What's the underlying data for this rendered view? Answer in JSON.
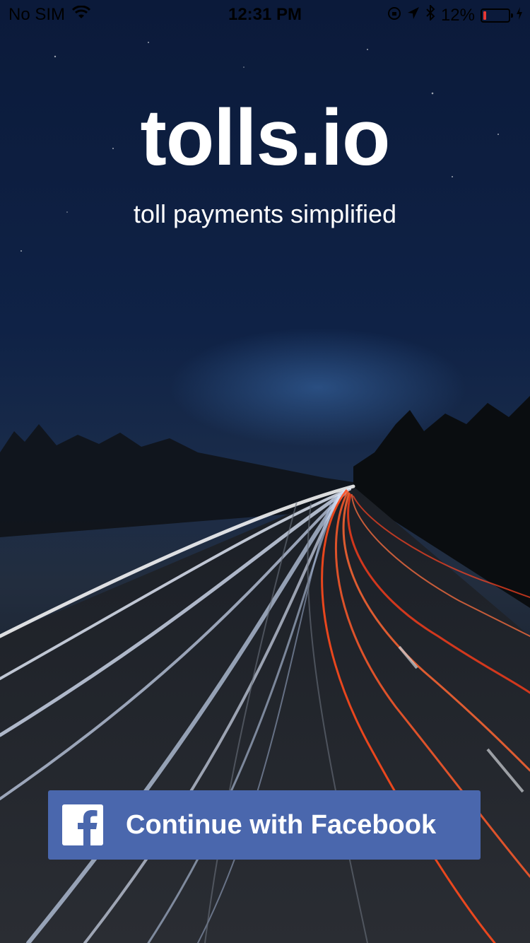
{
  "status_bar": {
    "carrier": "No SIM",
    "time": "12:31 PM",
    "battery_percent": "12%",
    "battery_level": 0.12,
    "icons": [
      "wifi-icon",
      "orientation-lock-icon",
      "location-icon",
      "bluetooth-icon",
      "battery-icon",
      "charging-icon"
    ]
  },
  "app": {
    "title": "tolls.io",
    "tagline": "toll payments simplified"
  },
  "login": {
    "facebook_label": "Continue with Facebook",
    "icon": "facebook-icon"
  },
  "colors": {
    "facebook_blue": "#4a67ad",
    "sky_top": "#0b1a3a",
    "battery_low": "#e53935",
    "tail_light": "#ff4a1c"
  }
}
